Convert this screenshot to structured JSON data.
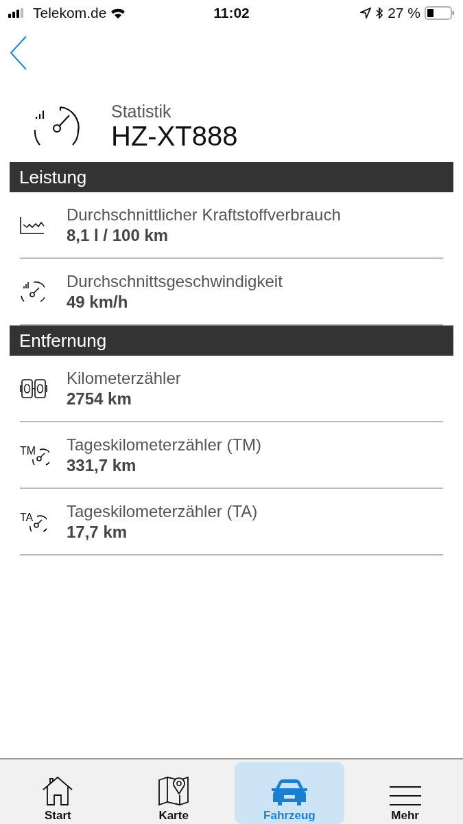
{
  "status_bar": {
    "carrier": "Telekom.de",
    "time": "11:02",
    "battery": "27 %"
  },
  "header": {
    "subtitle": "Statistik",
    "title": "HZ-XT888"
  },
  "sections": [
    {
      "title": "Leistung",
      "items": [
        {
          "kind": "chart",
          "label": "Durchschnittlicher Kraftstoffverbrauch",
          "value": "8,1 l / 100 km"
        },
        {
          "kind": "speed",
          "label": "Durchschnittsgeschwindigkeit",
          "value": "49 km/h"
        }
      ]
    },
    {
      "title": "Entfernung",
      "items": [
        {
          "kind": "odometer",
          "label": "Kilometerzähler",
          "value": "2754 km"
        },
        {
          "kind": "trip",
          "icon_text": "TM",
          "label": "Tageskilometerzähler (TM)",
          "value": "331,7 km"
        },
        {
          "kind": "trip",
          "icon_text": "TA",
          "label": "Tageskilometerzähler (TA)",
          "value": "17,7 km"
        }
      ]
    }
  ],
  "tabs": [
    {
      "kind": "home",
      "label": "Start",
      "selected": false
    },
    {
      "kind": "map",
      "label": "Karte",
      "selected": false
    },
    {
      "kind": "car",
      "label": "Fahrzeug",
      "selected": true
    },
    {
      "kind": "menu",
      "label": "Mehr",
      "selected": false
    }
  ]
}
